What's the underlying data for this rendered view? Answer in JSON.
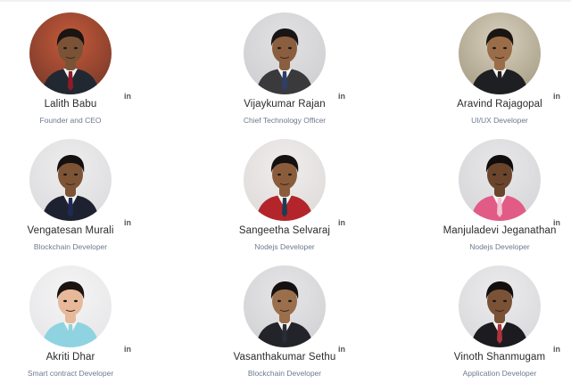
{
  "team": [
    {
      "name": "Lalith Babu",
      "role": "Founder and CEO",
      "linkedin_label": "in",
      "bg": "#c65a3a",
      "bg2": "#7a3a2a",
      "suit": "#222831",
      "tie": "#8e1b2a",
      "skin": "#7a5336",
      "hair": "#1a1412"
    },
    {
      "name": "Vijaykumar Rajan",
      "role": "Chief Technology Officer",
      "linkedin_label": "in",
      "bg": "#e2e2e4",
      "bg2": "#cfcfd2",
      "suit": "#3a3a3c",
      "tie": "#2d3e6b",
      "skin": "#8a5e3e",
      "hair": "#191514"
    },
    {
      "name": "Aravind Rajagopal",
      "role": "UI/UX Developer",
      "linkedin_label": "in",
      "bg": "#d8d1bf",
      "bg2": "#a89e86",
      "suit": "#1e1f22",
      "tie": "#1e1f22",
      "skin": "#9a6d48",
      "hair": "#1a1512"
    },
    {
      "name": "Vengatesan Murali",
      "role": "Blockchain Developer",
      "linkedin_label": "in",
      "bg": "#eeeeef",
      "bg2": "#dcdcde",
      "suit": "#1e2230",
      "tie": "#1c2a55",
      "skin": "#7d5436",
      "hair": "#141110"
    },
    {
      "name": "Sangeetha Selvaraj",
      "role": "Nodejs Developer",
      "linkedin_label": "in",
      "bg": "#f0eeee",
      "bg2": "#dedbd9",
      "suit": "#b3252a",
      "tie": "#1f3b52",
      "skin": "#8b5c3c",
      "hair": "#141110"
    },
    {
      "name": "Manjuladevi Jeganathan",
      "role": "Nodejs Developer",
      "linkedin_label": "in",
      "bg": "#e8e8ea",
      "bg2": "#d6d6d9",
      "suit": "#e25b86",
      "tie": "#f0c5d4",
      "skin": "#6a452c",
      "hair": "#100d0c"
    },
    {
      "name": "Akriti Dhar",
      "role": "Smart contract Developer",
      "linkedin_label": "in",
      "bg": "#f5f5f6",
      "bg2": "#e6e6e8",
      "suit": "#8fd3e0",
      "tie": "#8fd3e0",
      "skin": "#e7b99a",
      "hair": "#1b1411"
    },
    {
      "name": "Vasanthakumar Sethu",
      "role": "Blockchain Developer",
      "linkedin_label": "in",
      "bg": "#e6e6e8",
      "bg2": "#d2d2d5",
      "suit": "#23242a",
      "tie": "#2a2c35",
      "skin": "#9b6f4c",
      "hair": "#141110"
    },
    {
      "name": "Vinoth Shanmugam",
      "role": "Application Developer",
      "linkedin_label": "in",
      "bg": "#ececee",
      "bg2": "#d9d9dc",
      "suit": "#1c1c20",
      "tie": "#b0343b",
      "skin": "#7a5235",
      "hair": "#120f0e"
    }
  ]
}
